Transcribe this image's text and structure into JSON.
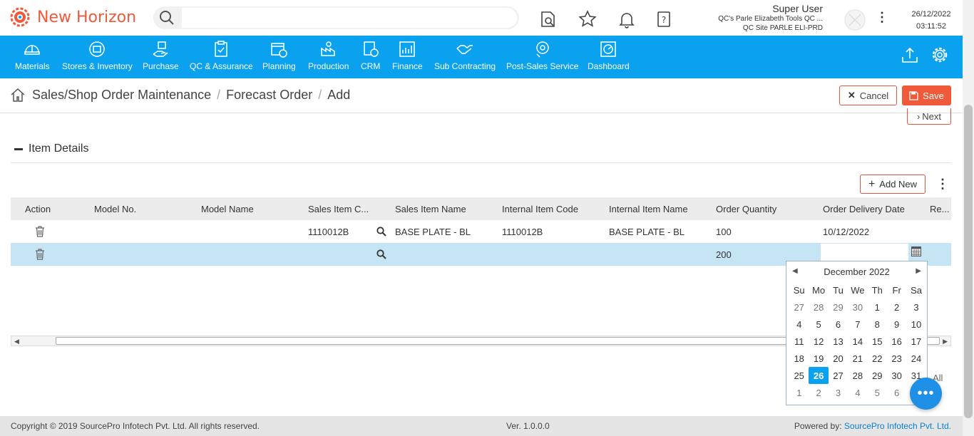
{
  "app": {
    "name": "New Horizon"
  },
  "search": {
    "placeholder": ""
  },
  "user": {
    "name": "Super User",
    "company": "QC's Parle Elizabeth Tools QC ...",
    "site": "QC Site PARLE ELI-PRD"
  },
  "datetime": {
    "date": "26/12/2022",
    "time": "03:11:52"
  },
  "nav": [
    {
      "label": "Materials",
      "icon": "helmet-icon"
    },
    {
      "label": "Stores & Inventory",
      "icon": "globe-box-icon"
    },
    {
      "label": "Purchase",
      "icon": "hand-box-icon"
    },
    {
      "label": "QC & Assurance",
      "icon": "clipboard-check-icon"
    },
    {
      "label": "Planning",
      "icon": "calendar-clock-icon"
    },
    {
      "label": "Production",
      "icon": "factory-icon"
    },
    {
      "label": "CRM",
      "icon": "crm-icon"
    },
    {
      "label": "Finance",
      "icon": "bar-chart-icon"
    },
    {
      "label": "Sub Contracting",
      "icon": "handshake-icon"
    },
    {
      "label": "Post-Sales Service",
      "icon": "service-gear-icon"
    },
    {
      "label": "Dashboard",
      "icon": "dashboard-icon"
    }
  ],
  "breadcrumb": {
    "part1": "Sales/Shop Order Maintenance",
    "part2": "Forecast Order",
    "part3": "Add",
    "sep": "/"
  },
  "buttons": {
    "cancel": "Cancel",
    "save": "Save",
    "next": "Next",
    "add_new": "Add New"
  },
  "section": {
    "title": "Item Details"
  },
  "grid": {
    "headers": [
      "Action",
      "Model No.",
      "Model Name",
      "Sales Item C...",
      "Sales Item Name",
      "Internal Item Code",
      "Internal Item Name",
      "Order Quantity",
      "Order Delivery Date",
      "Re..."
    ],
    "rows": [
      {
        "model_no": "",
        "model_name": "",
        "sales_item_code": "1110012B",
        "sales_item_name": "BASE PLATE - BL",
        "internal_item_code": "1110012B",
        "internal_item_name": "BASE PLATE - BL",
        "order_quantity": "100",
        "delivery_date": "10/12/2022"
      },
      {
        "model_no": "",
        "model_name": "",
        "sales_item_code": "",
        "sales_item_name": "",
        "internal_item_code": "",
        "internal_item_name": "",
        "order_quantity": "200",
        "delivery_date": ""
      }
    ]
  },
  "pager": {
    "all_label": "All"
  },
  "calendar": {
    "month_label": "December 2022",
    "days_of_week": [
      "Su",
      "Mo",
      "Tu",
      "We",
      "Th",
      "Fr",
      "Sa"
    ],
    "weeks": [
      [
        "27",
        "28",
        "29",
        "30",
        "1",
        "2",
        "3"
      ],
      [
        "4",
        "5",
        "6",
        "7",
        "8",
        "9",
        "10"
      ],
      [
        "11",
        "12",
        "13",
        "14",
        "15",
        "16",
        "17"
      ],
      [
        "18",
        "19",
        "20",
        "21",
        "22",
        "23",
        "24"
      ],
      [
        "25",
        "26",
        "27",
        "28",
        "29",
        "30",
        "31"
      ],
      [
        "1",
        "2",
        "3",
        "4",
        "5",
        "6",
        ""
      ]
    ],
    "selected": "26"
  },
  "footer": {
    "copyright": "Copyright © 2019 SourcePro Infotech Pvt. Ltd. All rights reserved.",
    "version": "Ver. 1.0.0.0",
    "powered_prefix": "Powered by:",
    "powered_link": "SourcePro Infotech Pvt. Ltd."
  },
  "colors": {
    "brand": "#f05a3a",
    "nav": "#0aa1ee",
    "row_highlight": "#c5e5f5"
  }
}
